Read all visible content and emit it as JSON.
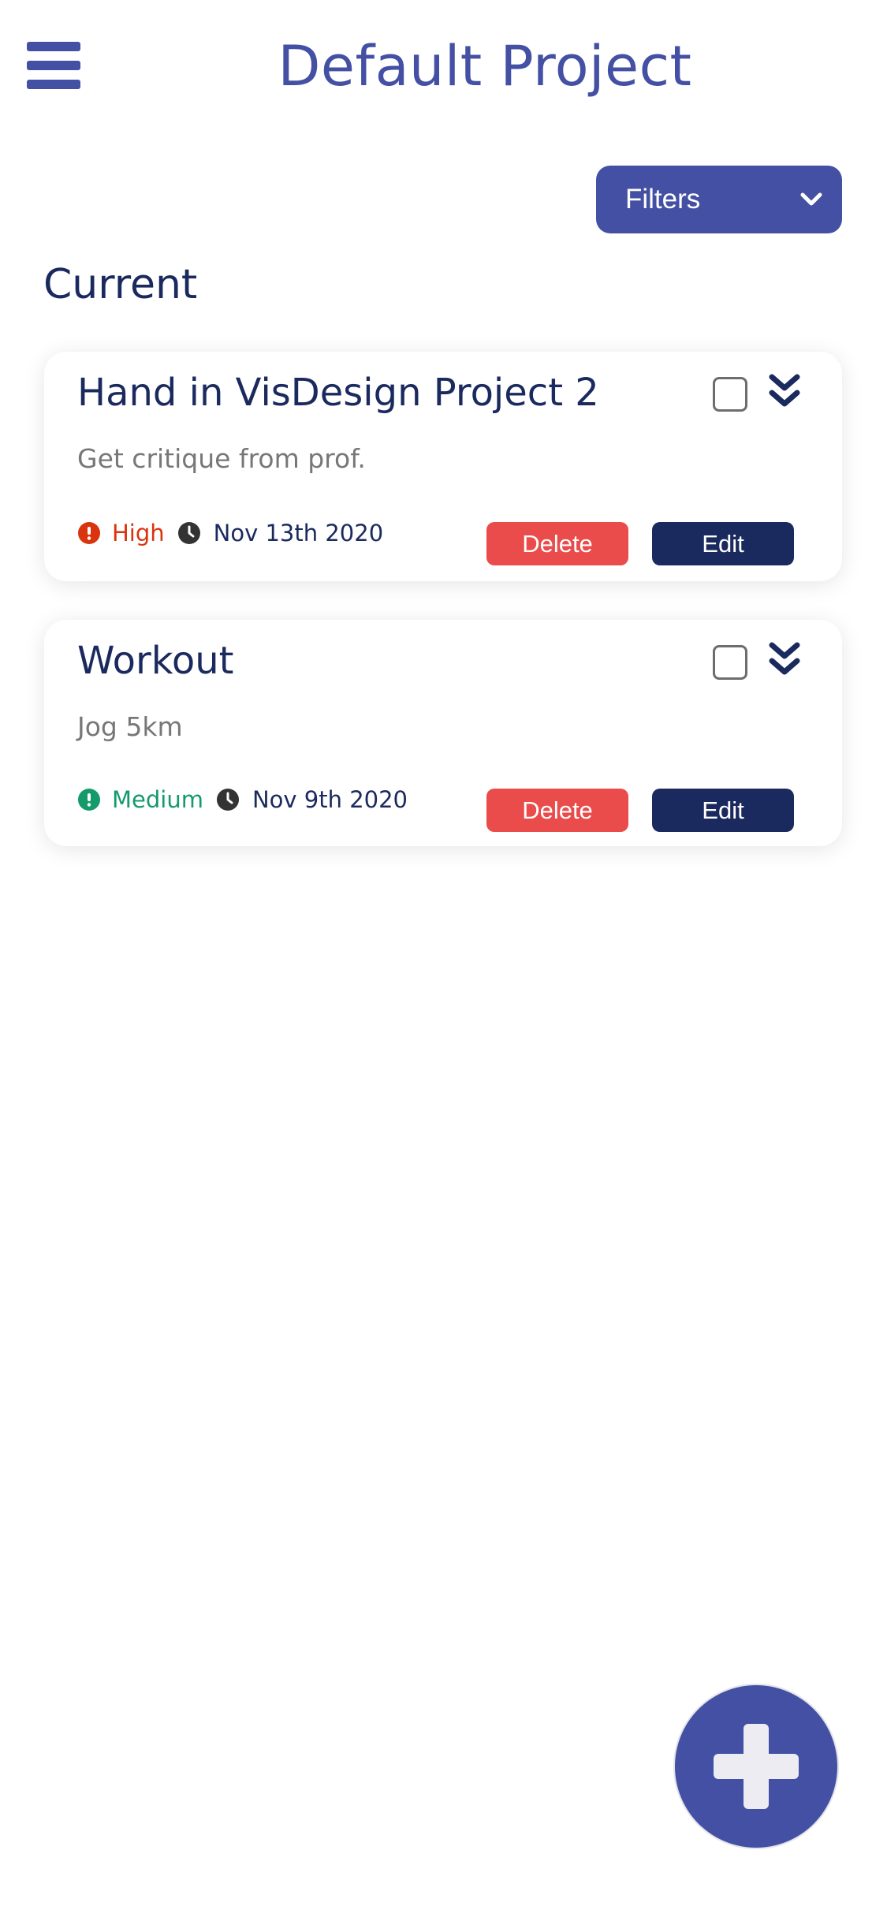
{
  "header": {
    "title": "Default Project",
    "menu_icon": "hamburger-menu-icon"
  },
  "filters": {
    "label": "Filters",
    "icon": "chevron-down-icon"
  },
  "section": {
    "title": "Current"
  },
  "tasks": [
    {
      "title": "Hand in VisDesign Project 2",
      "description": "Get critique from prof.",
      "priority": "High",
      "priority_color": "#d9340e",
      "due_date": "Nov 13th 2020",
      "completed": false,
      "delete_label": "Delete",
      "edit_label": "Edit"
    },
    {
      "title": "Workout",
      "description": "Jog 5km",
      "priority": "Medium",
      "priority_color": "#159a6c",
      "due_date": "Nov 9th 2020",
      "completed": false,
      "delete_label": "Delete",
      "edit_label": "Edit"
    }
  ],
  "colors": {
    "primary": "#4350a3",
    "dark_navy": "#1b2a5e",
    "delete_red": "#ea4b4b",
    "muted_text": "#777777"
  },
  "fab": {
    "icon": "plus-icon"
  }
}
